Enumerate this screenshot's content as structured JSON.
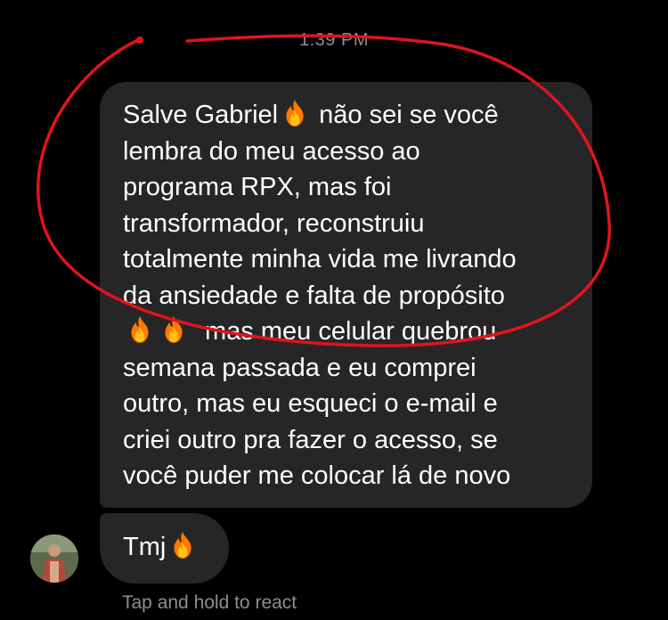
{
  "header": {
    "timestamp": "1:39 PM"
  },
  "messages": [
    {
      "lines": [
        {
          "before": "Salve Gabriel",
          "icons": [
            "fire-emoji"
          ],
          "after": " não sei se você"
        },
        {
          "text": "lembra do meu acesso ao"
        },
        {
          "text": "programa RPX, mas foi"
        },
        {
          "text": "transformador, reconstruiu"
        },
        {
          "text": "totalmente minha vida me livrando"
        },
        {
          "text": "da ansiedade e falta de propósito"
        },
        {
          "icons": [
            "fire-emoji",
            "fire-emoji"
          ],
          "after": " mas meu celular quebrou"
        },
        {
          "text": "semana passada e eu comprei"
        },
        {
          "text": "outro, mas eu esqueci o e-mail e"
        },
        {
          "text": "criei outro pra fazer o acesso, se"
        },
        {
          "text": "você puder me colocar lá de novo"
        }
      ]
    },
    {
      "text": "Tmj",
      "icons": [
        "fire-emoji"
      ]
    }
  ],
  "footer": {
    "hint": "Tap and hold to react"
  },
  "colors": {
    "background": "#000000",
    "bubble": "#262628",
    "meta_text": "#8e8e93",
    "annotation": "#e0141c"
  },
  "avatar": {
    "icon": "user-avatar"
  }
}
